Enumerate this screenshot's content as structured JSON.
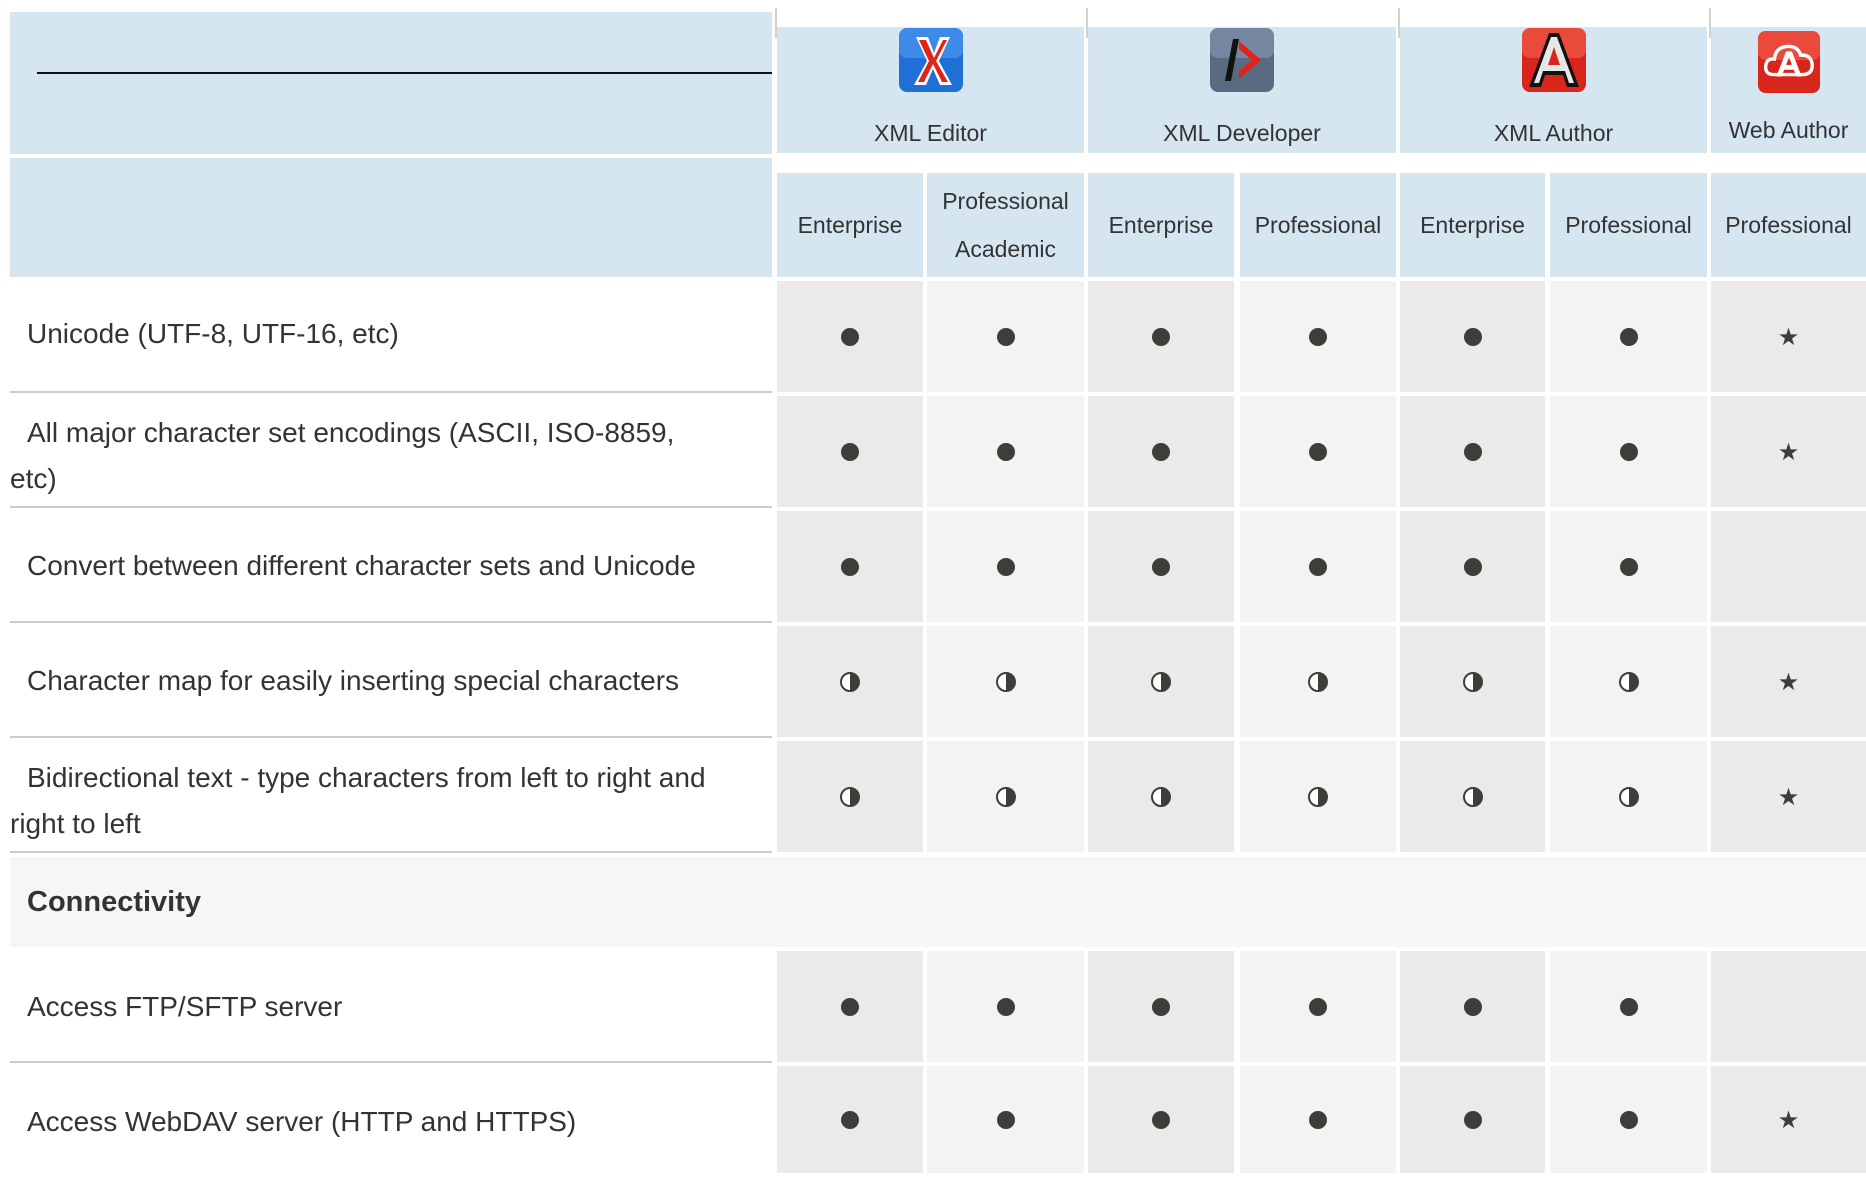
{
  "products": [
    {
      "name": "XML Editor",
      "icon": "xml-editor-logo-icon",
      "color": "#1f6fd6"
    },
    {
      "name": "XML Developer",
      "icon": "xml-developer-logo-icon",
      "color": "#5a6a80"
    },
    {
      "name": "XML Author",
      "icon": "xml-author-logo-icon",
      "color": "#d9261c"
    },
    {
      "name": "Web Author",
      "icon": "web-author-logo-icon",
      "color": "#d9261c"
    }
  ],
  "editions": [
    {
      "line1": "Enterprise",
      "line2": ""
    },
    {
      "line1": "Professional",
      "line2": "Academic"
    },
    {
      "line1": "Enterprise",
      "line2": ""
    },
    {
      "line1": "Professional",
      "line2": ""
    },
    {
      "line1": "Enterprise",
      "line2": ""
    },
    {
      "line1": "Professional",
      "line2": ""
    },
    {
      "line1": "Professional",
      "line2": ""
    }
  ],
  "legend_marks": {
    "full": "full-support-dot",
    "partial": "partial-support-half-circle",
    "star": "web-author-star"
  },
  "rows": [
    {
      "line1": "Unicode (UTF-8, UTF-16, etc)",
      "line2": "",
      "marks": [
        "full",
        "full",
        "full",
        "full",
        "full",
        "full",
        "star"
      ]
    },
    {
      "line1": "All major character set encodings (ASCII, ISO-8859,",
      "line2": "etc)",
      "marks": [
        "full",
        "full",
        "full",
        "full",
        "full",
        "full",
        "star"
      ]
    },
    {
      "line1": "Convert between different character sets and Unicode",
      "line2": "",
      "marks": [
        "full",
        "full",
        "full",
        "full",
        "full",
        "full",
        "none"
      ]
    },
    {
      "line1": "Character map for easily inserting special characters",
      "line2": "",
      "marks": [
        "half",
        "half",
        "half",
        "half",
        "half",
        "half",
        "star"
      ]
    },
    {
      "line1": "Bidirectional text - type characters from left to right and",
      "line2": "right to left",
      "marks": [
        "half",
        "half",
        "half",
        "half",
        "half",
        "half",
        "star"
      ]
    }
  ],
  "section": {
    "title": "Connectivity"
  },
  "rows2": [
    {
      "line1": "Access FTP/SFTP server",
      "line2": "",
      "marks": [
        "full",
        "full",
        "full",
        "full",
        "full",
        "full",
        "none"
      ]
    },
    {
      "line1": "Access WebDAV server (HTTP and HTTPS)",
      "line2": "",
      "marks": [
        "full",
        "full",
        "full",
        "full",
        "full",
        "full",
        "star"
      ]
    }
  ]
}
